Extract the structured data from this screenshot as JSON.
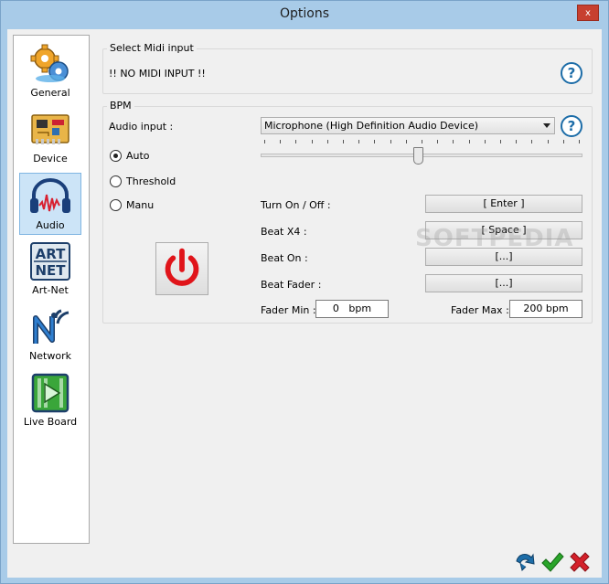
{
  "window": {
    "title": "Options",
    "close_label": "x"
  },
  "sidebar": {
    "items": [
      {
        "label": "General",
        "icon": "gears-icon"
      },
      {
        "label": "Device",
        "icon": "circuit-board-icon"
      },
      {
        "label": "Audio",
        "icon": "headphones-icon",
        "active": true
      },
      {
        "label": "Art-Net",
        "icon": "artnet-logo-icon"
      },
      {
        "label": "Network",
        "icon": "network-signal-icon"
      },
      {
        "label": "Live Board",
        "icon": "play-board-icon"
      }
    ],
    "artnet_logo_text": [
      "ART",
      "NET"
    ]
  },
  "midi": {
    "group_title": "Select Midi input",
    "status_text": "!! NO MIDI INPUT !!",
    "help_glyph": "?"
  },
  "bpm": {
    "group_title": "BPM",
    "audio_input_label": "Audio input :",
    "audio_input_value": "Microphone (High Definition Audio Device)",
    "help_glyph": "?",
    "modes": [
      {
        "label": "Auto",
        "checked": true
      },
      {
        "label": "Threshold",
        "checked": false
      },
      {
        "label": "Manu",
        "checked": false
      }
    ],
    "sensitivity_fraction": 0.49,
    "shortcuts": [
      {
        "label": "Turn On / Off :",
        "value": "[ Enter ]"
      },
      {
        "label": "Beat X4 :",
        "value": "[ Space ]"
      },
      {
        "label": "Beat On :",
        "value": "[...]"
      },
      {
        "label": "Beat Fader :",
        "value": "[...]"
      }
    ],
    "fader_min_label": "Fader Min :",
    "fader_min_value": "0   bpm",
    "fader_max_label": "Fader Max :",
    "fader_max_value": "200 bpm"
  },
  "watermark": "SOFTPEDIA",
  "footer": {
    "back_icon": "back-arrow-icon",
    "ok_icon": "checkmark-icon",
    "cancel_icon": "cross-icon"
  },
  "colors": {
    "accent_blue": "#1d6da8",
    "power_red": "#e0141a",
    "ok_green": "#2aa52a",
    "cancel_red": "#d4202a"
  }
}
